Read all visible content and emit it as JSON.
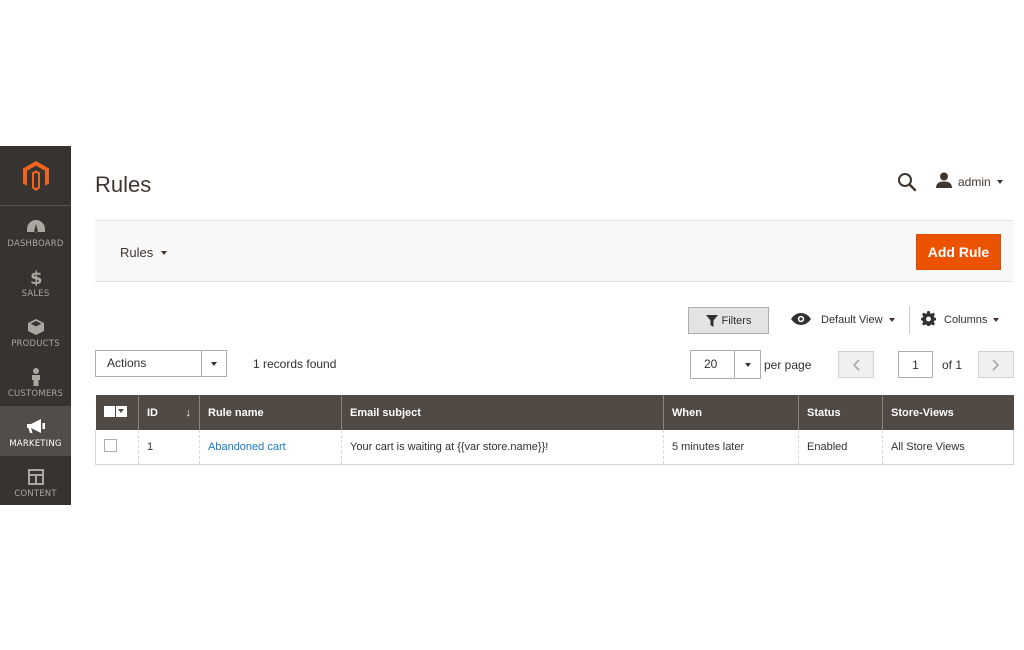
{
  "sidebar": {
    "items": [
      {
        "label": "Dashboard",
        "icon": "dashboard-icon"
      },
      {
        "label": "Sales",
        "icon": "dollar-icon"
      },
      {
        "label": "Products",
        "icon": "cube-icon"
      },
      {
        "label": "Customers",
        "icon": "person-icon"
      },
      {
        "label": "Marketing",
        "icon": "megaphone-icon",
        "active": true
      },
      {
        "label": "Content",
        "icon": "layout-icon"
      }
    ]
  },
  "header": {
    "title": "Rules",
    "user_name": "admin"
  },
  "action_bar": {
    "switcher_label": "Rules",
    "add_button": "Add Rule"
  },
  "toolbar": {
    "filters_label": "Filters",
    "view_label": "Default View",
    "columns_label": "Columns",
    "actions_value": "Actions",
    "records_found": "1 records found",
    "per_page_value": "20",
    "per_page_label": "per page",
    "current_page": "1",
    "page_of": "of 1"
  },
  "grid": {
    "columns": [
      "ID",
      "Rule name",
      "Email subject",
      "When",
      "Status",
      "Store-Views"
    ],
    "sort_indicator": "↓",
    "rows": [
      {
        "id": "1",
        "rule_name": "Abandoned cart",
        "email_subject": "Your cart is waiting at {{var store.name}}!",
        "when": "5 minutes later",
        "status": "Enabled",
        "store_views": "All Store Views"
      }
    ]
  },
  "colors": {
    "accent": "#eb5202",
    "sidebar_bg": "#373330",
    "table_header_bg": "#514943",
    "link": "#1979c3"
  }
}
